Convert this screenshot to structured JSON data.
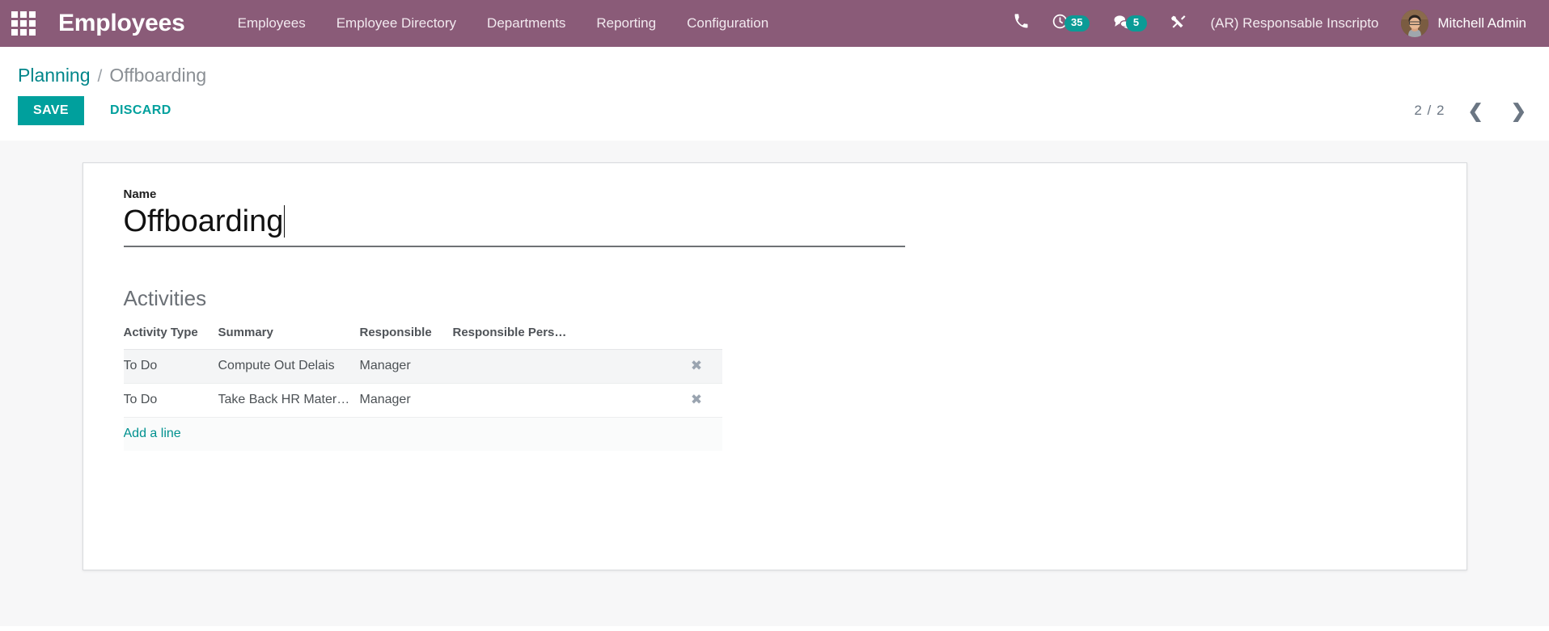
{
  "colors": {
    "navbar_bg": "#8a5b78",
    "accent_teal": "#00a09d",
    "badge_teal": "#0b9b96",
    "sheet_bg": "#f7f7f8"
  },
  "navbar": {
    "apps_icon": "apps-grid-icon",
    "brand": "Employees",
    "menu": [
      {
        "label": "Employees"
      },
      {
        "label": "Employee Directory"
      },
      {
        "label": "Departments"
      },
      {
        "label": "Reporting"
      },
      {
        "label": "Configuration"
      }
    ],
    "systray": {
      "phone_icon": "phone-icon",
      "activity_icon": "clock-activity-icon",
      "activity_count": "35",
      "messages_icon": "chat-bubbles-icon",
      "messages_count": "5",
      "debug_icon": "wrench-tools-icon",
      "company": "(AR) Responsable Inscripto",
      "avatar_icon": "user-avatar",
      "user_name": "Mitchell Admin"
    }
  },
  "control_panel": {
    "breadcrumb": {
      "parent": "Planning",
      "separator": "/",
      "current": "Offboarding"
    },
    "save_label": "SAVE",
    "discard_label": "DISCARD",
    "pager": {
      "count": "2 / 2",
      "prev_icon": "chevron-left-icon",
      "next_icon": "chevron-right-icon"
    }
  },
  "form": {
    "name_label": "Name",
    "name_value": "Offboarding",
    "name_placeholder": "Name",
    "activities_title": "Activities",
    "activities": {
      "columns": [
        "Activity Type",
        "Summary",
        "Responsible",
        "Responsible Pers…"
      ],
      "rows": [
        {
          "activity_type": "To Do",
          "summary": "Compute Out Delais",
          "responsible": "Manager",
          "responsible_person": "",
          "delete_icon": "✖"
        },
        {
          "activity_type": "To Do",
          "summary": "Take Back HR Materia…",
          "responsible": "Manager",
          "responsible_person": "",
          "delete_icon": "✖"
        }
      ],
      "add_line_label": "Add a line"
    }
  }
}
